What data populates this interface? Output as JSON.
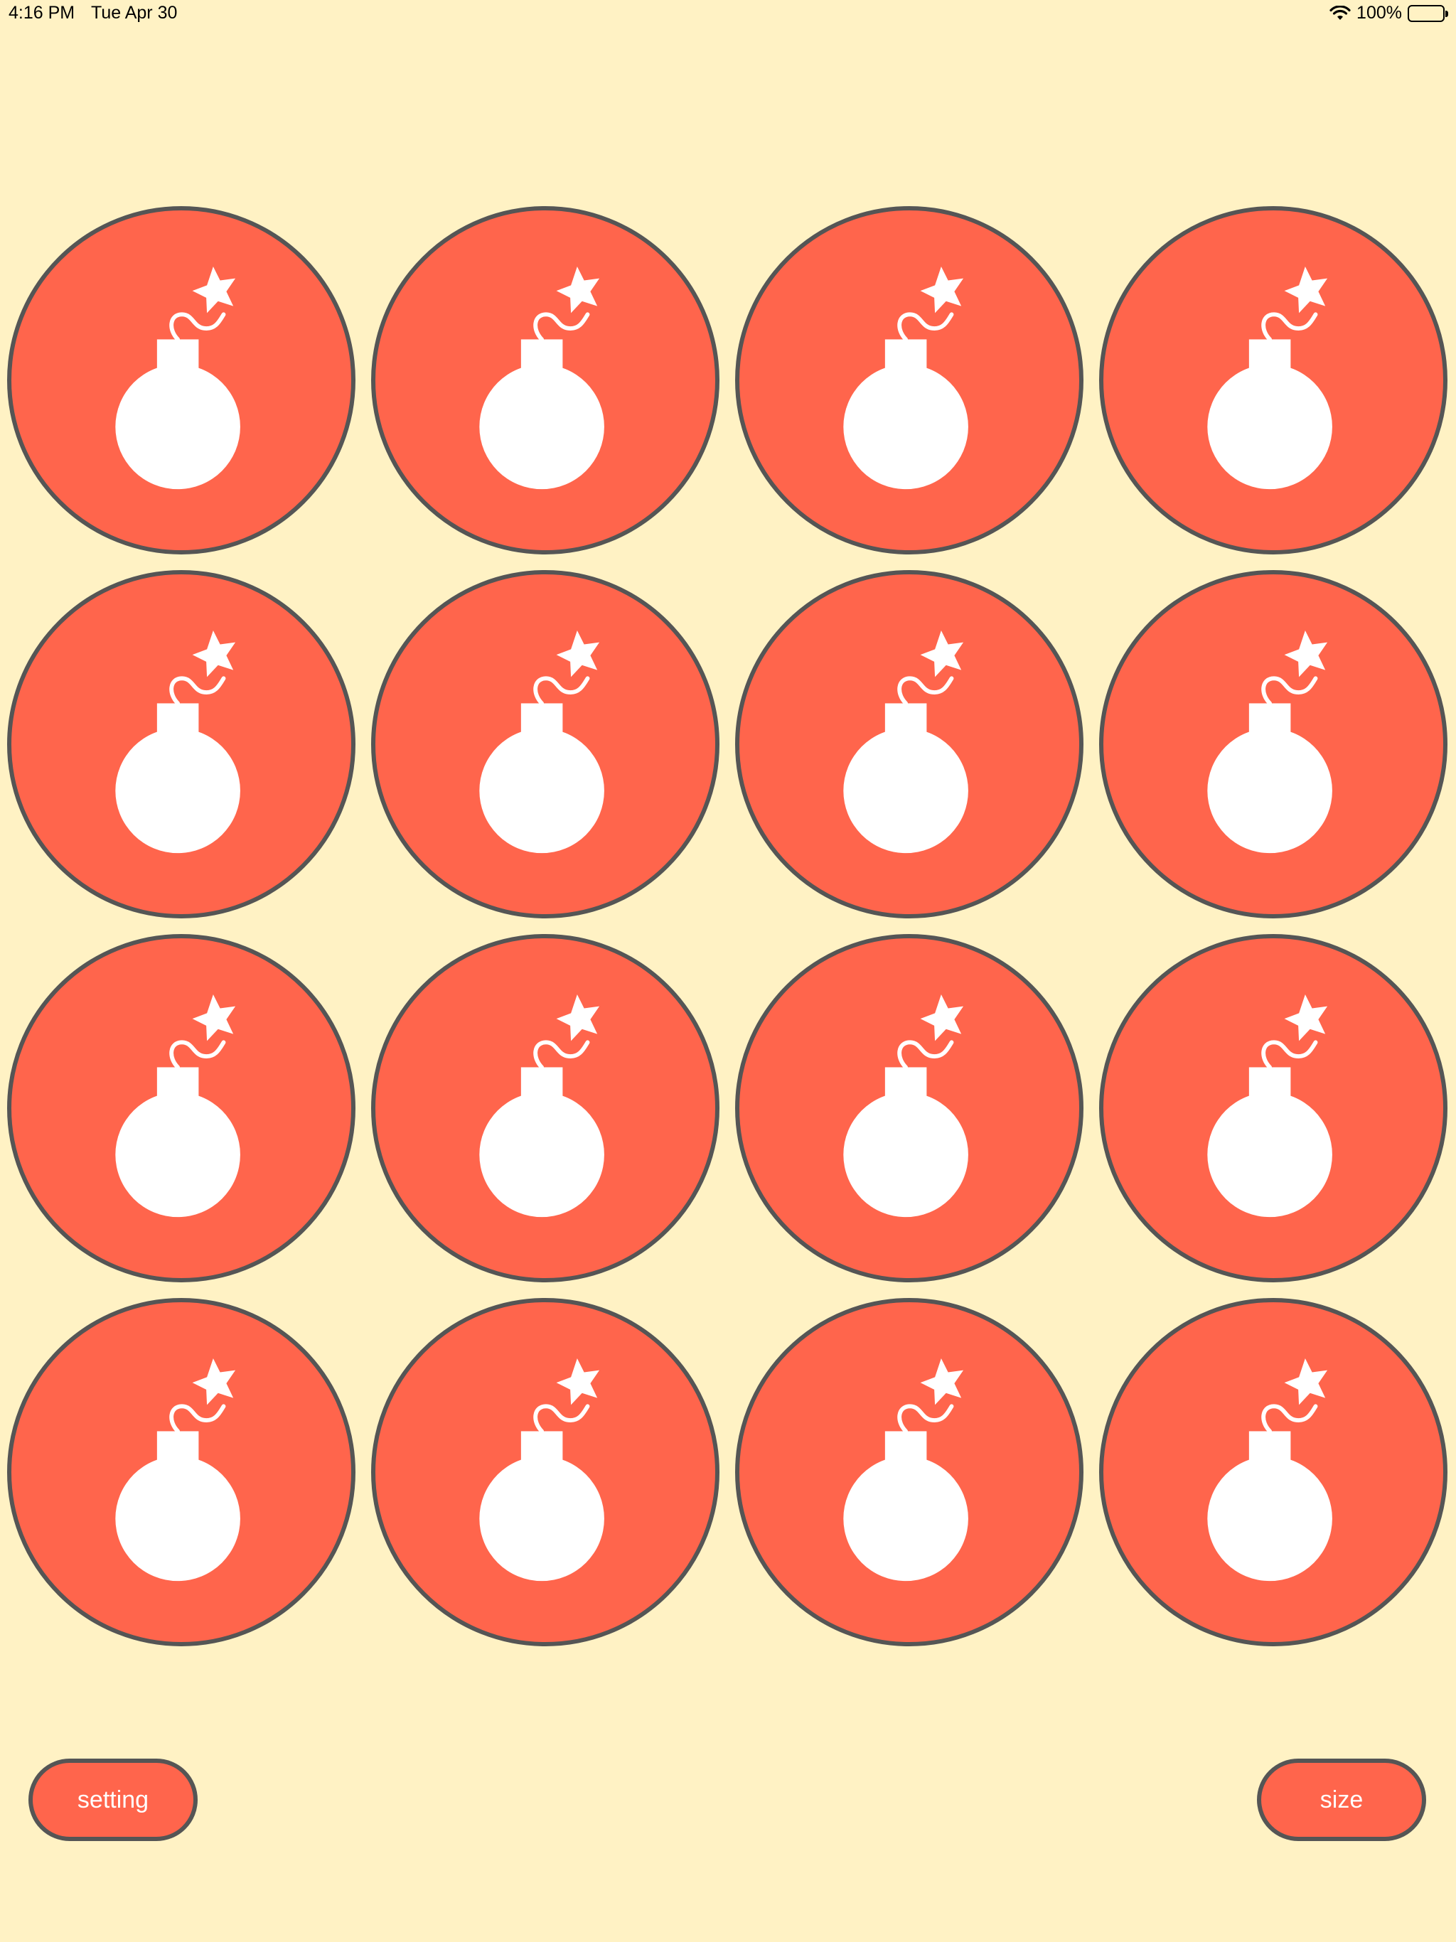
{
  "status_bar": {
    "time": "4:16 PM",
    "date": "Tue Apr 30",
    "battery": "100%",
    "icons": [
      "wifi-icon",
      "battery-icon"
    ]
  },
  "board": {
    "rows": 4,
    "columns": 4,
    "tile_icon": "bomb-icon",
    "tile_color": "#FF654C",
    "border_color": "#555555",
    "icon_color": "#FFFFFF"
  },
  "buttons": {
    "setting_label": "setting",
    "size_label": "size"
  },
  "colors": {
    "background": "#FFF2C4",
    "accent": "#FF654C"
  }
}
